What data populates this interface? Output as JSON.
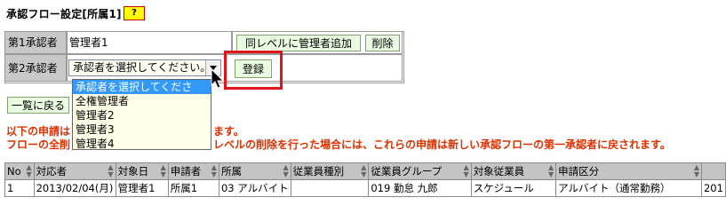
{
  "page": {
    "title": "承認フロー設定[所属1]",
    "help_label": "?"
  },
  "approvers": {
    "first_label": "第1承認者",
    "first_value": "管理者1",
    "add_same_level_button": "同レベルに管理者追加",
    "delete_button": "削除",
    "second_label": "第2承認者",
    "select_value": "承認者を選択してください。",
    "register_button": "登録"
  },
  "dropdown": {
    "options": [
      "承認者を選択してください。",
      "全権管理者",
      "管理者2",
      "管理者3",
      "管理者4"
    ],
    "selected_index": 0
  },
  "back_button": "一覧に戻る",
  "notice": {
    "line1_start": "以下の申請は",
    "line1_end": "ます。",
    "line2_start": "フローの全削",
    "line2_end": "レベルの削除を行った場合には、これらの申請は新しい承認フローの第一承認者に戻されます。"
  },
  "table": {
    "headers": [
      "No",
      "対応者",
      "対象日",
      "申請者",
      "所属",
      "従業員種別",
      "従業員グループ",
      "対象従業員",
      "申請区分"
    ],
    "rows": [
      [
        "1",
        "2013/02/04(月)",
        "管理者1",
        "所属1",
        "03 アルバイト",
        "",
        "019 勤怠 九郎",
        "スケジュール",
        "アルバイト（通常勤務）"
      ]
    ],
    "extra_cell": "201"
  },
  "colors": {
    "accent_red": "#e0161b",
    "button_bg": "#e9fbe1",
    "header_bg": "#c4c4c4",
    "selection": "#3399ff"
  }
}
